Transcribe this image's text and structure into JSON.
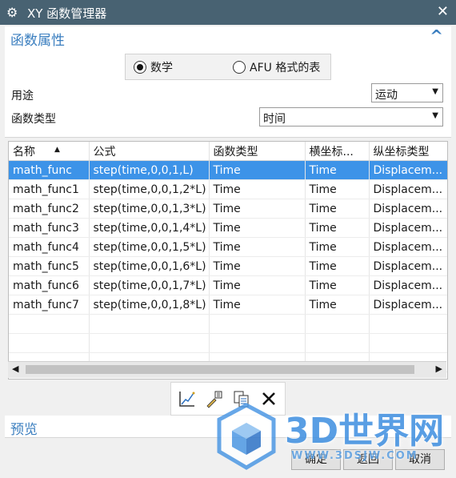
{
  "window": {
    "title": "XY 函数管理器"
  },
  "properties": {
    "section_title": "函数属性",
    "radio_math": "数学",
    "radio_afu": "AFU 格式的表",
    "purpose_label": "用途",
    "purpose_value": "运动",
    "func_type_label": "函数类型",
    "func_type_value": "时间"
  },
  "table": {
    "headers": [
      "名称",
      "公式",
      "函数类型",
      "横坐标...",
      "纵坐标类型"
    ],
    "rows": [
      [
        "math_func",
        "step(time,0,0,1,L)",
        "Time",
        "Time",
        "Displacem..."
      ],
      [
        "math_func1",
        "step(time,0,0,1,2*L)",
        "Time",
        "Time",
        "Displacem..."
      ],
      [
        "math_func2",
        "step(time,0,0,1,3*L)",
        "Time",
        "Time",
        "Displacem..."
      ],
      [
        "math_func3",
        "step(time,0,0,1,4*L)",
        "Time",
        "Time",
        "Displacem..."
      ],
      [
        "math_func4",
        "step(time,0,0,1,5*L)",
        "Time",
        "Time",
        "Displacem..."
      ],
      [
        "math_func5",
        "step(time,0,0,1,6*L)",
        "Time",
        "Time",
        "Displacem..."
      ],
      [
        "math_func6",
        "step(time,0,0,1,7*L)",
        "Time",
        "Time",
        "Displacem..."
      ],
      [
        "math_func7",
        "step(time,0,0,1,8*L)",
        "Time",
        "Time",
        "Displacem..."
      ]
    ],
    "selected_row": 0
  },
  "preview": {
    "section_title": "预览"
  },
  "buttons": {
    "ok": "确定",
    "back": "返回",
    "cancel": "取消"
  },
  "watermark": {
    "brand": "3D世界网",
    "url": "WWW.3DSJW.COM"
  },
  "colors": {
    "titlebar": "#486272",
    "accent": "#3a7ebf",
    "selection": "#3d93e8"
  }
}
